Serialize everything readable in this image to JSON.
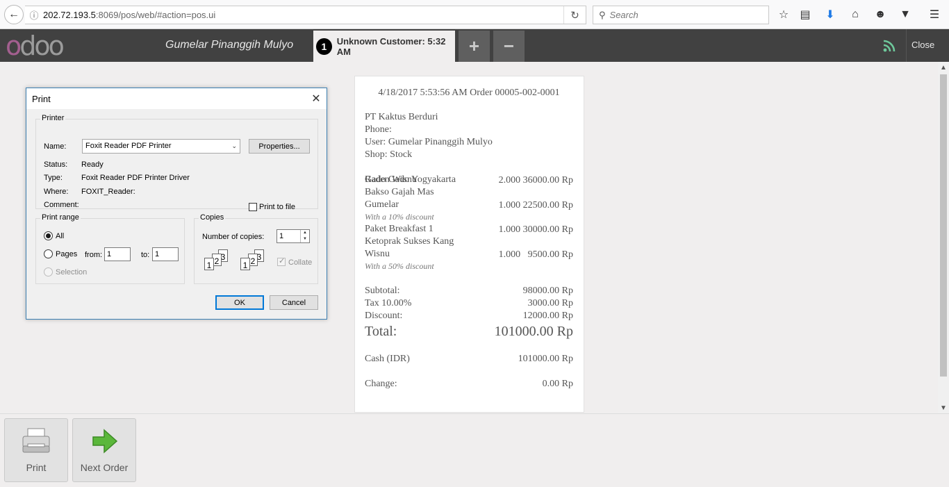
{
  "browser": {
    "url_host": "202.72.193.5",
    "url_path": ":8069/pos/web/#action=pos.ui",
    "search_placeholder": "Search"
  },
  "header": {
    "user_name": "Gumelar Pinanggih Mulyo",
    "order_number": "1",
    "order_label": "Unknown Customer: 5:32 AM",
    "add_label": "+",
    "remove_label": "−",
    "close_label": "Close"
  },
  "receipt": {
    "header": "4/18/2017 5:53:56 AM Order 00005-002-0001",
    "company": "PT Kaktus Berduri",
    "phone": "Phone:",
    "user": "User: Gumelar Pinanggih Mulyo",
    "shop": "Shop: Stock",
    "items": [
      {
        "name_line1": "Gado Gado Yogyakarta",
        "name_line2": "Raden Wisnu",
        "qty": "2.000",
        "price": "36000.00 Rp",
        "discount": ""
      },
      {
        "name_line1": "Bakso Gajah Mas",
        "name_line2": "Gumelar",
        "qty": "1.000",
        "price": "22500.00 Rp",
        "discount": "With a 10% discount"
      },
      {
        "name_line1": "",
        "name_line2": "Paket Breakfast 1",
        "qty": "1.000",
        "price": "30000.00 Rp",
        "discount": ""
      },
      {
        "name_line1": "Ketoprak Sukses Kang",
        "name_line2": "Wisnu",
        "qty": "1.000",
        "price": "9500.00 Rp",
        "discount": "With a 50% discount"
      }
    ],
    "subtotal_label": "Subtotal:",
    "subtotal_value": "98000.00 Rp",
    "tax_label": "Tax 10.00%",
    "tax_value": "3000.00 Rp",
    "discount_label": "Discount:",
    "discount_value": "12000.00 Rp",
    "total_label": "Total:",
    "total_value": "101000.00 Rp",
    "cash_label": "Cash (IDR)",
    "cash_value": "101000.00 Rp",
    "change_label": "Change:",
    "change_value": "0.00 Rp"
  },
  "bottom": {
    "print_label": "Print",
    "next_label": "Next Order"
  },
  "dialog": {
    "title": "Print",
    "printer_group": "Printer",
    "name_label": "Name:",
    "name_value": "Foxit Reader PDF Printer",
    "properties_label": "Properties...",
    "status_label": "Status:",
    "status_value": "Ready",
    "type_label": "Type:",
    "type_value": "Foxit Reader PDF Printer Driver",
    "where_label": "Where:",
    "where_value": "FOXIT_Reader:",
    "comment_label": "Comment:",
    "print_to_file_label": "Print to file",
    "range_group": "Print range",
    "all_label": "All",
    "pages_label": "Pages",
    "from_label": "from:",
    "from_value": "1",
    "to_label": "to:",
    "to_value": "1",
    "selection_label": "Selection",
    "copies_group": "Copies",
    "num_copies_label": "Number of copies:",
    "num_copies_value": "1",
    "collate_label": "Collate",
    "ok_label": "OK",
    "cancel_label": "Cancel"
  }
}
